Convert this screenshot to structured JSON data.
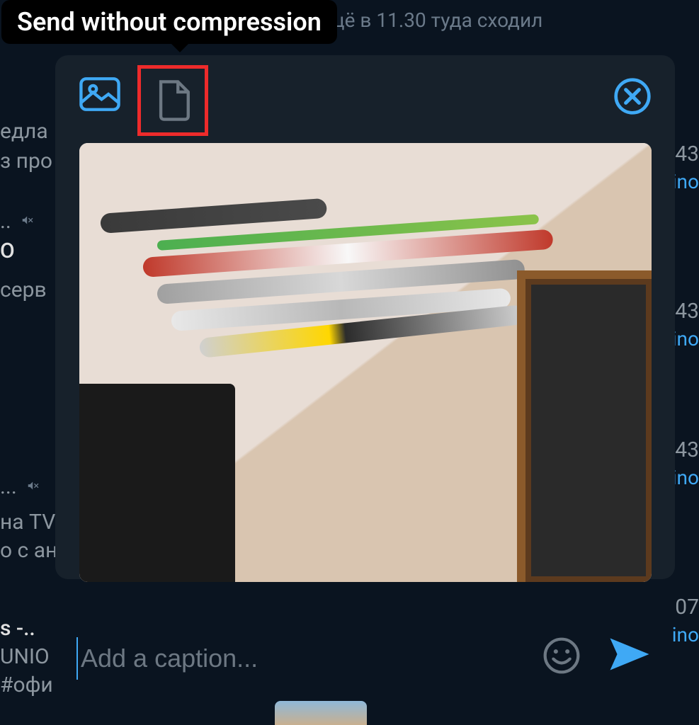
{
  "tooltip": {
    "text": "Send without compression"
  },
  "background": {
    "top_message": "цё в 11.30 туда сходил",
    "left_fragments": {
      "f1": "едла",
      "f2": "з про",
      "f3": "..",
      "f4": "О",
      "f5": "серв",
      "f6": "...",
      "f7": "на TV",
      "f8": "о с ан",
      "f9": "s -..",
      "f10": "UNIO",
      "f11": "#офи"
    },
    "right_fragments": {
      "t1": "43",
      "r1": "ino",
      "t2": "43",
      "r2": "ino",
      "t3": "43",
      "r3": "ino",
      "t4": "07",
      "r4": "ino"
    }
  },
  "caption": {
    "placeholder": "Add a caption...",
    "value": ""
  },
  "icons": {
    "photo_mode": "image-icon",
    "file_mode": "file-icon",
    "close": "close-icon",
    "emoji": "emoji-icon",
    "send": "send-icon",
    "muted": "muted-icon"
  },
  "colors": {
    "accent": "#3fa9f5",
    "highlight_box": "#ee2b2b",
    "panel_bg": "#17212b",
    "page_bg": "#0a1420",
    "placeholder": "#6d7883",
    "icon_muted": "#6d7883"
  }
}
